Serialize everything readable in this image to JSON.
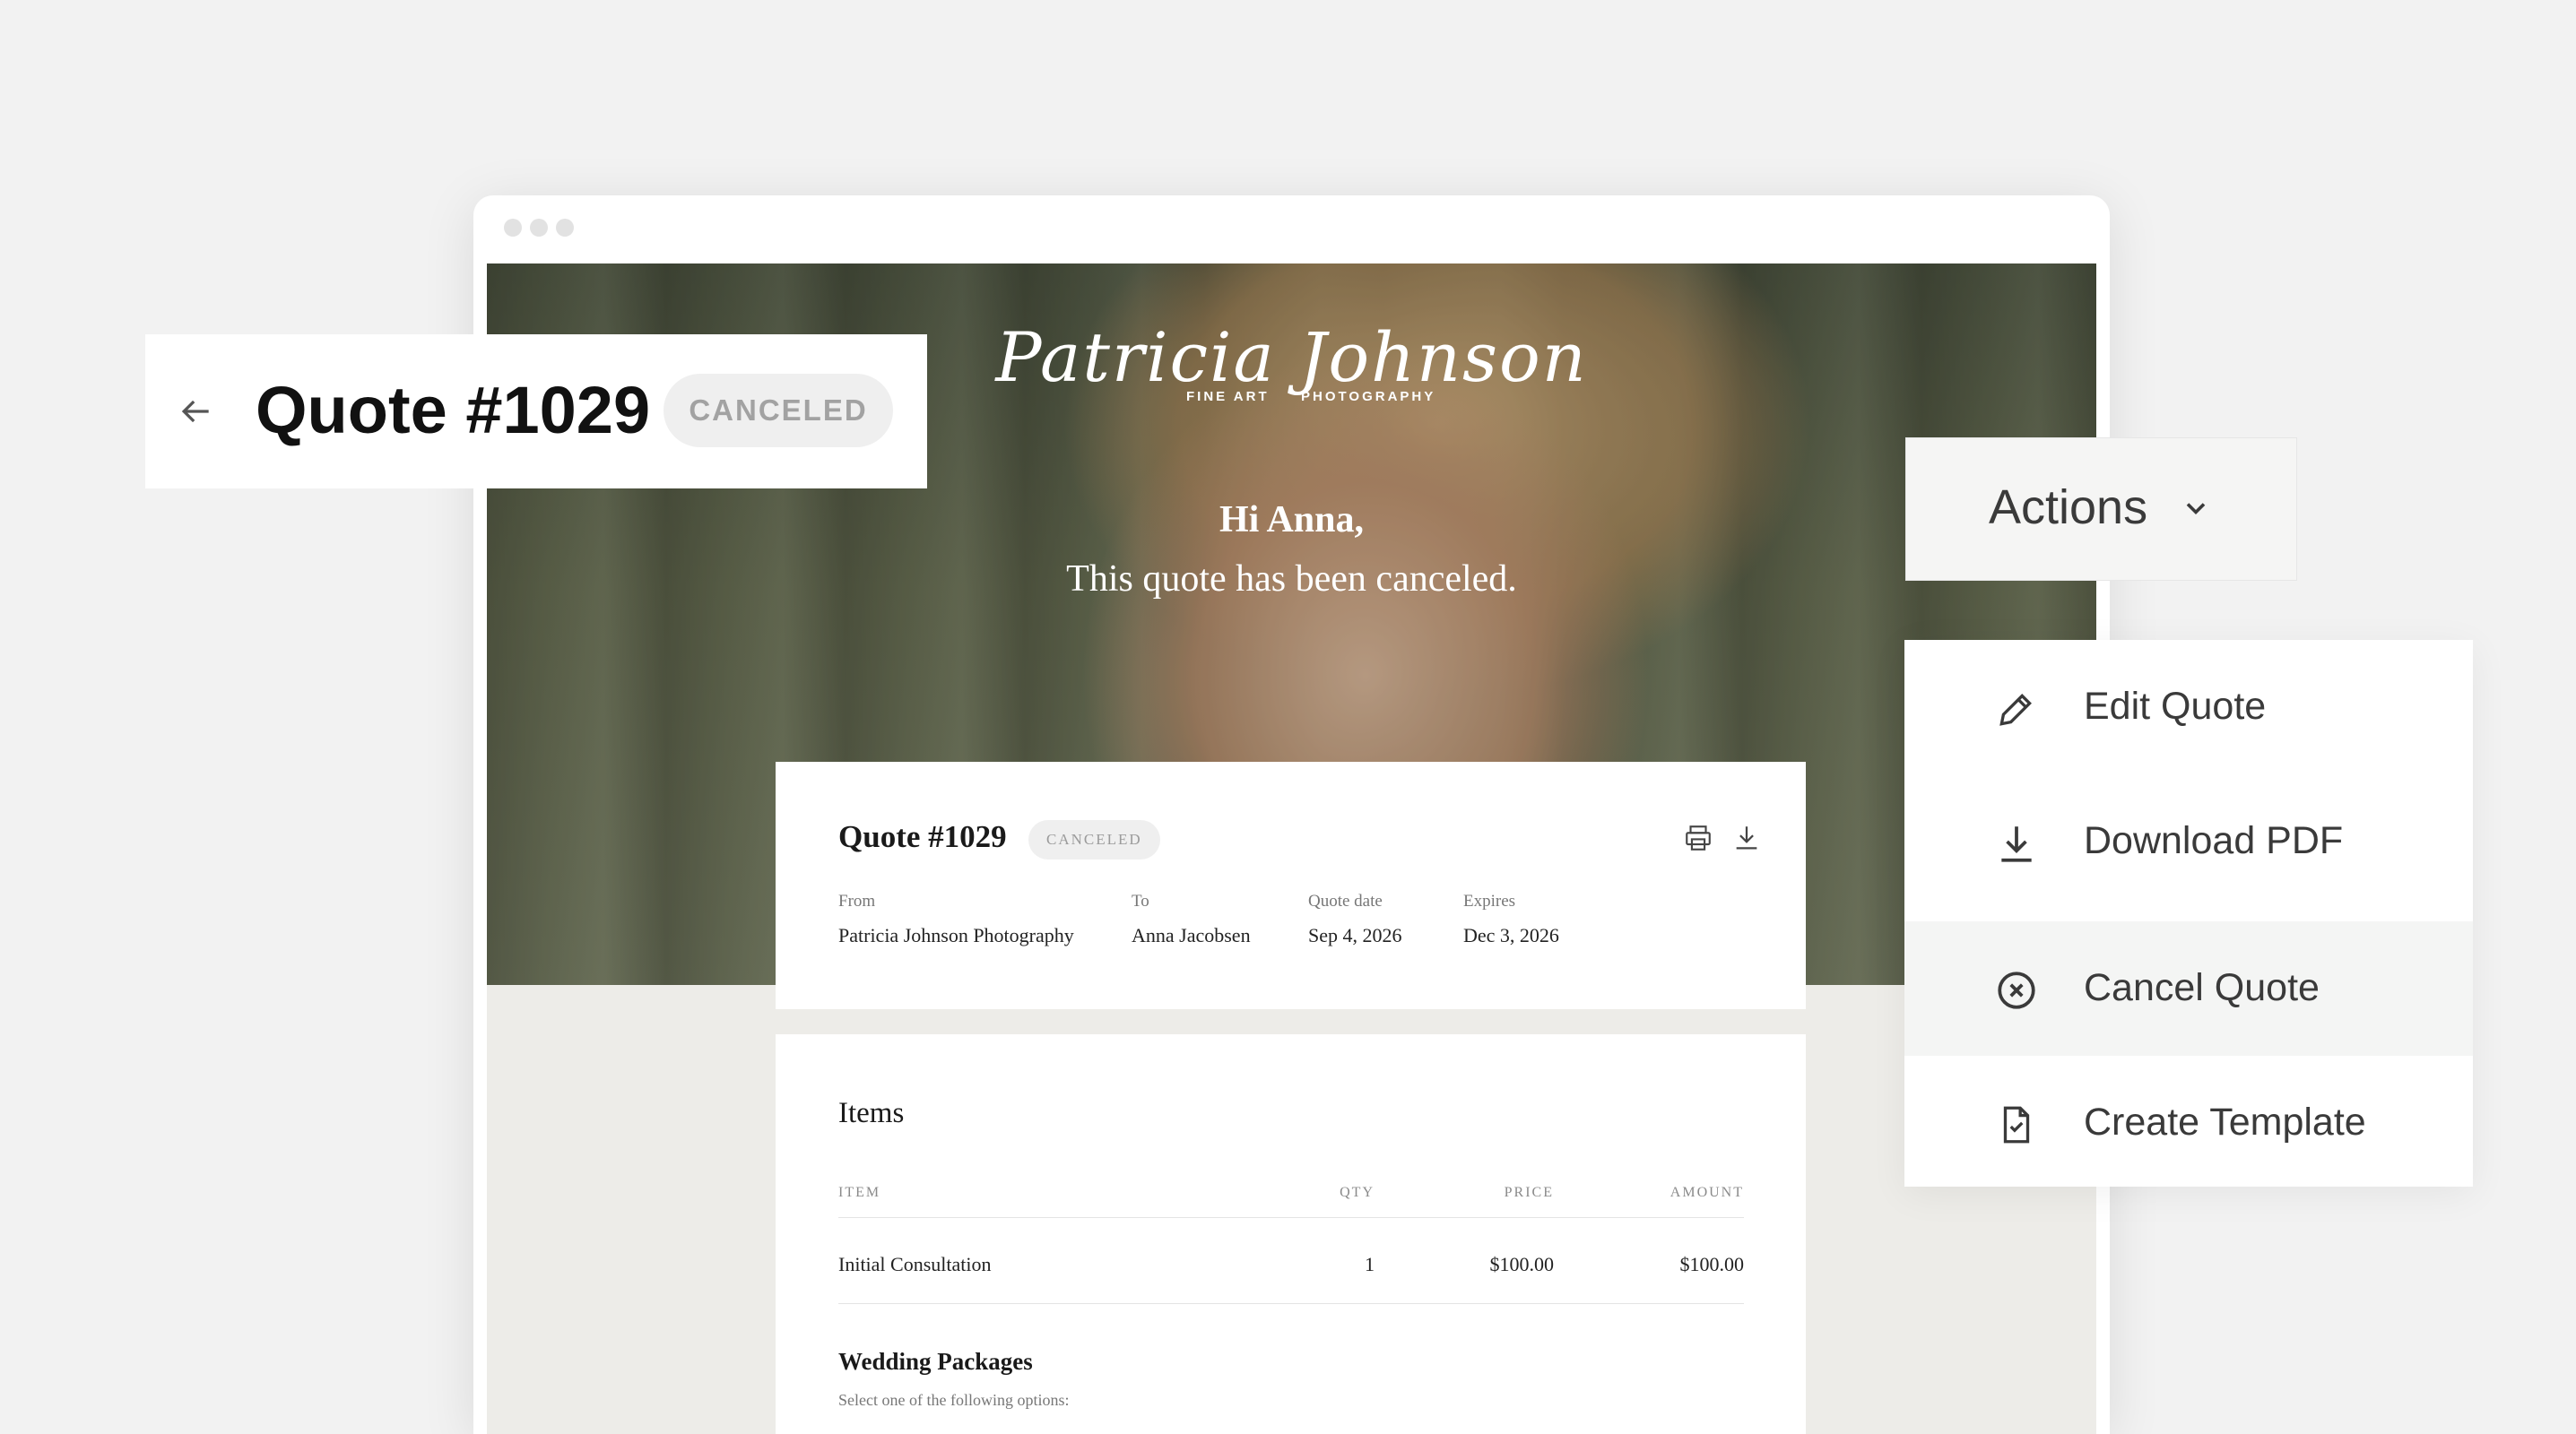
{
  "header": {
    "title": "Quote #1029",
    "status": "CANCELED"
  },
  "actions": {
    "label": "Actions"
  },
  "menu": {
    "items": [
      {
        "label": "Edit Quote",
        "icon": "pencil-icon"
      },
      {
        "label": "Download PDF",
        "icon": "download-icon"
      },
      {
        "label": "Cancel Quote",
        "icon": "cancel-circle-icon"
      },
      {
        "label": "Create Template",
        "icon": "template-file-icon"
      }
    ]
  },
  "hero": {
    "logo_script": "Patricia Johnson",
    "logo_sub_left": "FINE ART",
    "logo_sub_right": "PHOTOGRAPHY",
    "greeting": "Hi Anna,",
    "message": "This quote has been canceled."
  },
  "quote": {
    "title": "Quote #1029",
    "status": "CANCELED",
    "fields": [
      {
        "label": "From",
        "value": "Patricia Johnson Photography"
      },
      {
        "label": "To",
        "value": "Anna Jacobsen"
      },
      {
        "label": "Quote date",
        "value": "Sep 4, 2026"
      },
      {
        "label": "Expires",
        "value": "Dec 3, 2026"
      }
    ]
  },
  "items": {
    "heading": "Items",
    "columns": [
      "ITEM",
      "QTY",
      "PRICE",
      "AMOUNT"
    ],
    "rows": [
      {
        "item": "Initial Consultation",
        "qty": "1",
        "price": "$100.00",
        "amount": "$100.00"
      }
    ],
    "packages_heading": "Wedding Packages",
    "packages_note": "Select one of the following options:"
  },
  "colors": {
    "page_bg": "#f2f2f2",
    "badge_bg": "#efefef",
    "badge_text": "#9b9b9b",
    "highlight_row": "#f4f5f4"
  }
}
